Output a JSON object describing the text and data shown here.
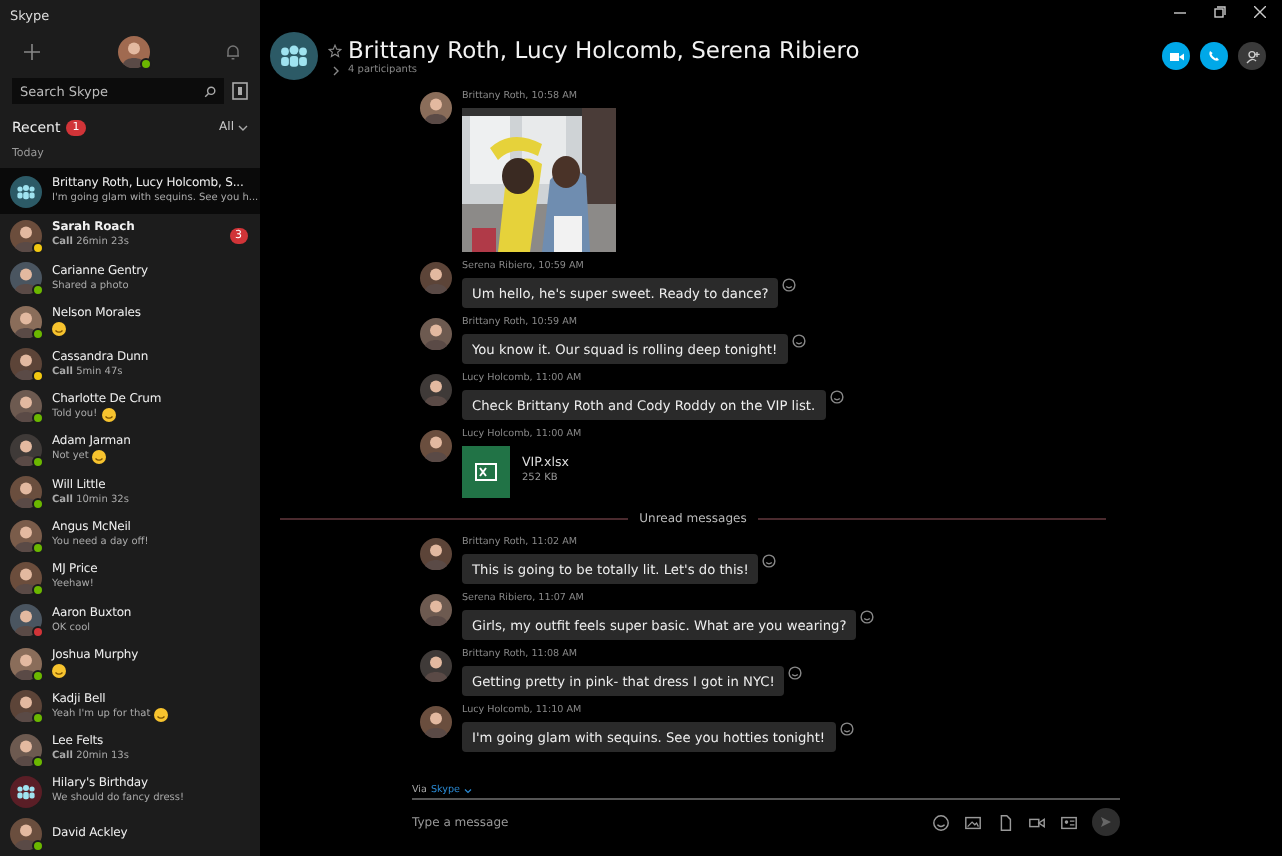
{
  "window": {
    "title": "Skype"
  },
  "sidebar": {
    "search": {
      "placeholder": "Search Skype"
    },
    "recent": {
      "label": "Recent",
      "badge": "1",
      "filter": "All"
    },
    "section": "Today",
    "conversations": [
      {
        "kind": "group",
        "name": "Brittany Roth, Lucy Holcomb, S...",
        "preview": "I'm going glam with sequins. See you h...",
        "selected": true
      },
      {
        "kind": "contact",
        "name": "Sarah Roach",
        "preview": "**Call** 26min 23s",
        "color": "#f2c811",
        "badge": "3",
        "selected": false
      },
      {
        "kind": "contact",
        "name": "Carianne Gentry",
        "preview": "Shared a photo",
        "color": "#6bb700",
        "selected": false
      },
      {
        "kind": "contact",
        "name": "Nelson Morales",
        "emoji": true,
        "color": "#6bb700",
        "selected": false
      },
      {
        "kind": "contact",
        "name": "Cassandra Dunn",
        "preview": "**Call** 5min 47s",
        "color": "#f2c811",
        "selected": false
      },
      {
        "kind": "contact",
        "name": "Charlotte De Crum",
        "preview": "Told you!",
        "emoji": true,
        "color": "#6bb700",
        "selected": false
      },
      {
        "kind": "contact",
        "name": "Adam Jarman",
        "preview": "Not yet",
        "emoji": true,
        "color": "#6bb700",
        "selected": false
      },
      {
        "kind": "contact",
        "name": "Will Little",
        "preview": "**Call** 10min 32s",
        "color": "#6bb700",
        "selected": false
      },
      {
        "kind": "contact",
        "name": "Angus McNeil",
        "preview": "You need a day off!",
        "color": "#6bb700",
        "selected": false
      },
      {
        "kind": "contact",
        "name": "MJ Price",
        "preview": "Yeehaw!",
        "color": "#6bb700",
        "selected": false
      },
      {
        "kind": "contact",
        "name": "Aaron Buxton",
        "preview": "OK cool",
        "color": "#d13438",
        "selected": false
      },
      {
        "kind": "contact",
        "name": "Joshua Murphy",
        "emoji": true,
        "color": "#6bb700",
        "selected": false
      },
      {
        "kind": "contact",
        "name": "Kadji Bell",
        "preview": "Yeah I'm up for that",
        "emoji": true,
        "color": "#6bb700",
        "selected": false
      },
      {
        "kind": "contact",
        "name": "Lee Felts",
        "preview": "**Call** 20min 13s",
        "color": "#6bb700",
        "selected": false
      },
      {
        "kind": "group",
        "name": "Hilary's Birthday",
        "preview": "We should do fancy dress!",
        "selected": false
      },
      {
        "kind": "contact",
        "name": "David Ackley",
        "color": "#6bb700",
        "selected": false
      }
    ]
  },
  "conversation": {
    "title": "Brittany Roth, Lucy Holcomb, Serena Ribiero",
    "subtitle": "4 participants",
    "favorite": false,
    "messages": [
      {
        "meta": "Brittany Roth, 10:58 AM"
      },
      {
        "kind": "text",
        "meta": "Serena Ribiero, 10:59 AM",
        "text": "Um hello, he's super sweet. Ready to dance?"
      },
      {
        "kind": "text",
        "meta": "Brittany Roth, 10:59 AM",
        "text": "You know it. Our squad is rolling deep tonight!"
      },
      {
        "kind": "text",
        "meta": "Lucy Holcomb, 11:00 AM",
        "text": "Check Brittany Roth and Cody Roddy on the VIP list."
      },
      {
        "kind": "file",
        "meta": "Lucy Holcomb, 11:00 AM",
        "file_name": "VIP.xlsx",
        "file_size": "252 KB"
      }
    ],
    "unread_label": "Unread messages",
    "unread_messages": [
      {
        "kind": "text",
        "meta": "Brittany Roth, 11:02 AM",
        "text": "This is going to be totally lit. Let's do this!"
      },
      {
        "kind": "text",
        "meta": "Serena Ribiero, 11:07 AM",
        "text": "Girls, my outfit feels super basic. What are you wearing?"
      },
      {
        "kind": "text",
        "meta": "Brittany Roth, 11:08 AM",
        "text": "Getting pretty in pink- that dress I got in NYC!"
      },
      {
        "kind": "text",
        "meta": "Lucy Holcomb, 11:10 AM",
        "text": "I'm going glam with sequins. See you hotties tonight!"
      }
    ]
  },
  "composer": {
    "via": "Via",
    "service": "Skype",
    "placeholder": "Type a message"
  }
}
